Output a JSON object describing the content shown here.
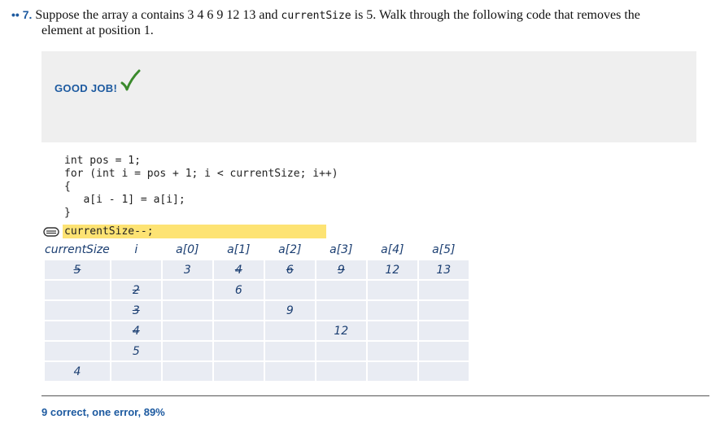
{
  "question": {
    "number_prefix": "•• 7.",
    "text_part1": "Suppose the array a contains 3 4 6 9 12 13 and",
    "code_term": "currentSize",
    "text_part2": "is 5. Walk through the following code that removes the",
    "text_line2": "element at position 1."
  },
  "feedback": {
    "message": "GOOD JOB!",
    "check_color": "#3a8a2c"
  },
  "code": {
    "lines": [
      "int pos = 1;",
      "for (int i = pos + 1; i < currentSize; i++)",
      "{",
      "   a[i - 1] = a[i];",
      "}"
    ],
    "highlighted_line": "currentSize--;",
    "highlight_color": "#fde373"
  },
  "trace_table": {
    "headers": [
      "currentSize",
      "i",
      "a[0]",
      "a[1]",
      "a[2]",
      "a[3]",
      "a[4]",
      "a[5]"
    ],
    "rows": [
      [
        "5",
        "",
        "3",
        "4",
        "6",
        "9",
        "12",
        "13"
      ],
      [
        "",
        "2",
        "",
        "6",
        "",
        "",
        "",
        ""
      ],
      [
        "",
        "3",
        "",
        "",
        "9",
        "",
        "",
        ""
      ],
      [
        "",
        "4",
        "",
        "",
        "",
        "12",
        "",
        ""
      ],
      [
        "",
        "5",
        "",
        "",
        "",
        "",
        "",
        ""
      ],
      [
        "4",
        "",
        "",
        "",
        "",
        "",
        "",
        ""
      ]
    ],
    "struck_cells": [
      "0-0",
      "1-1",
      "2-1",
      "3-1",
      "0-3",
      "0-4",
      "0-5"
    ]
  },
  "score": {
    "text": "9 correct, one error, 89%"
  }
}
